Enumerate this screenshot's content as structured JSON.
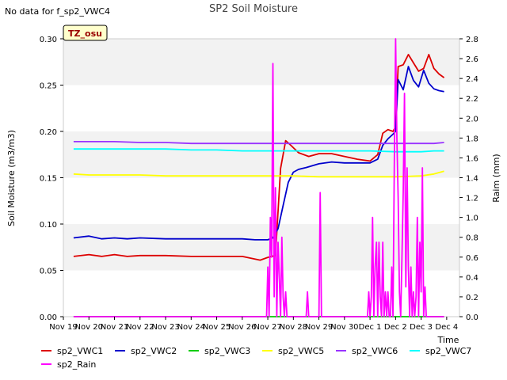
{
  "chart_data": {
    "type": "line",
    "title": "SP2 Soil Moisture",
    "corner_note": "No data for f_sp2_VWC4",
    "badge": "TZ_osu",
    "xlabel": "Time",
    "ylabel": "Soil Moisture (m3/m3)",
    "y2label": "Raim (mm)",
    "xlim": [
      0,
      15.5
    ],
    "ylim": [
      0,
      0.3
    ],
    "y2lim": [
      0,
      2.8
    ],
    "x_ticks": [
      {
        "x": 0,
        "label": "Nov 19"
      },
      {
        "x": 1,
        "label": "Nov 20"
      },
      {
        "x": 2,
        "label": "Nov 21"
      },
      {
        "x": 3,
        "label": "Nov 22"
      },
      {
        "x": 4,
        "label": "Nov 23"
      },
      {
        "x": 5,
        "label": "Nov 24"
      },
      {
        "x": 6,
        "label": "Nov 25"
      },
      {
        "x": 7,
        "label": "Nov 26"
      },
      {
        "x": 8,
        "label": "Nov 27"
      },
      {
        "x": 9,
        "label": "Nov 28"
      },
      {
        "x": 10,
        "label": "Nov 29"
      },
      {
        "x": 11,
        "label": "Nov 30"
      },
      {
        "x": 12,
        "label": "Dec 1"
      },
      {
        "x": 13,
        "label": "Dec 2"
      },
      {
        "x": 14,
        "label": "Dec 3"
      },
      {
        "x": 15,
        "label": "Dec 4"
      }
    ],
    "y_ticks": [
      "0.00",
      "0.05",
      "0.10",
      "0.15",
      "0.20",
      "0.25",
      "0.30"
    ],
    "y2_ticks": [
      "0.0",
      "0.2",
      "0.4",
      "0.6",
      "0.8",
      "1.0",
      "1.2",
      "1.4",
      "1.6",
      "1.8",
      "2.0",
      "2.2",
      "2.4",
      "2.6",
      "2.8"
    ],
    "series": [
      {
        "name": "sp2_VWC1",
        "axis": "left",
        "color": "#dd0000",
        "x": [
          0.4,
          1.0,
          1.5,
          2.0,
          2.5,
          3.0,
          4.0,
          5.0,
          6.0,
          7.0,
          7.7,
          8.0,
          8.3,
          8.5,
          8.7,
          8.9,
          9.2,
          9.6,
          10.0,
          10.5,
          11.0,
          11.5,
          12.0,
          12.3,
          12.5,
          12.7,
          12.9,
          13.0,
          13.1,
          13.3,
          13.5,
          13.7,
          13.9,
          14.1,
          14.3,
          14.5,
          14.7,
          14.9
        ],
        "y": [
          0.065,
          0.067,
          0.065,
          0.067,
          0.065,
          0.066,
          0.066,
          0.065,
          0.065,
          0.065,
          0.061,
          0.064,
          0.066,
          0.16,
          0.19,
          0.185,
          0.177,
          0.173,
          0.176,
          0.176,
          0.173,
          0.17,
          0.168,
          0.175,
          0.198,
          0.202,
          0.2,
          0.205,
          0.27,
          0.272,
          0.283,
          0.274,
          0.265,
          0.268,
          0.283,
          0.268,
          0.262,
          0.258
        ]
      },
      {
        "name": "sp2_VWC2",
        "axis": "left",
        "color": "#0000cc",
        "x": [
          0.4,
          1.0,
          1.5,
          2.0,
          2.5,
          3.0,
          4.0,
          5.0,
          6.0,
          7.0,
          7.5,
          8.0,
          8.2,
          8.4,
          8.6,
          8.8,
          9.0,
          9.2,
          9.5,
          10.0,
          10.5,
          11.0,
          11.5,
          12.0,
          12.3,
          12.5,
          12.7,
          12.9,
          13.0,
          13.1,
          13.3,
          13.5,
          13.7,
          13.9,
          14.1,
          14.3,
          14.5,
          14.7,
          14.9
        ],
        "y": [
          0.085,
          0.087,
          0.084,
          0.085,
          0.084,
          0.085,
          0.084,
          0.084,
          0.084,
          0.084,
          0.083,
          0.083,
          0.085,
          0.095,
          0.12,
          0.145,
          0.156,
          0.159,
          0.161,
          0.165,
          0.167,
          0.166,
          0.166,
          0.166,
          0.17,
          0.185,
          0.192,
          0.197,
          0.2,
          0.256,
          0.245,
          0.27,
          0.255,
          0.248,
          0.266,
          0.252,
          0.246,
          0.244,
          0.243
        ]
      },
      {
        "name": "sp2_VWC3",
        "axis": "left",
        "color": "#00cc00",
        "x": [
          0.4,
          14.9
        ],
        "y": [
          0.0,
          0.0
        ]
      },
      {
        "name": "sp2_VWC5",
        "axis": "left",
        "color": "#ffff00",
        "x": [
          0.4,
          1.0,
          2.0,
          3.0,
          4.0,
          5.0,
          6.0,
          7.0,
          8.0,
          9.0,
          10.0,
          11.0,
          12.0,
          13.0,
          14.0,
          14.5,
          14.9
        ],
        "y": [
          0.154,
          0.153,
          0.153,
          0.153,
          0.152,
          0.152,
          0.152,
          0.152,
          0.152,
          0.152,
          0.151,
          0.151,
          0.151,
          0.151,
          0.152,
          0.154,
          0.157
        ]
      },
      {
        "name": "sp2_VWC6",
        "axis": "left",
        "color": "#9933ff",
        "x": [
          0.4,
          1.0,
          2.0,
          3.0,
          4.0,
          5.0,
          6.0,
          7.0,
          8.0,
          9.0,
          10.0,
          11.0,
          12.0,
          13.0,
          14.0,
          14.5,
          14.9
        ],
        "y": [
          0.189,
          0.189,
          0.189,
          0.188,
          0.188,
          0.187,
          0.187,
          0.187,
          0.187,
          0.187,
          0.187,
          0.187,
          0.187,
          0.187,
          0.187,
          0.187,
          0.188
        ]
      },
      {
        "name": "sp2_VWC7",
        "axis": "left",
        "color": "#00ffff",
        "x": [
          0.4,
          1.0,
          2.0,
          3.0,
          4.0,
          5.0,
          6.0,
          7.0,
          8.0,
          9.0,
          10.0,
          11.0,
          12.0,
          13.0,
          14.0,
          14.5,
          14.9
        ],
        "y": [
          0.181,
          0.181,
          0.181,
          0.181,
          0.181,
          0.18,
          0.18,
          0.179,
          0.179,
          0.179,
          0.179,
          0.179,
          0.179,
          0.178,
          0.178,
          0.179,
          0.179
        ]
      },
      {
        "name": "sp2_Rain",
        "axis": "right",
        "color": "#ff00ff",
        "x": [
          0.4,
          7.95,
          8.0,
          8.05,
          8.1,
          8.15,
          8.2,
          8.25,
          8.3,
          8.35,
          8.4,
          8.45,
          8.5,
          8.55,
          8.6,
          8.65,
          8.7,
          8.75,
          8.8,
          9.5,
          9.55,
          9.6,
          10.0,
          10.05,
          10.1,
          10.15,
          10.2,
          11.9,
          11.95,
          12.0,
          12.05,
          12.1,
          12.15,
          12.2,
          12.25,
          12.3,
          12.35,
          12.4,
          12.45,
          12.5,
          12.55,
          12.6,
          12.65,
          12.7,
          12.75,
          12.8,
          12.85,
          12.9,
          12.95,
          13.0,
          13.05,
          13.1,
          13.15,
          13.2,
          13.25,
          13.3,
          13.35,
          13.4,
          13.45,
          13.5,
          13.55,
          13.6,
          13.65,
          13.7,
          13.75,
          13.8,
          13.85,
          13.9,
          13.95,
          14.0,
          14.05,
          14.1,
          14.15,
          14.2,
          14.25,
          14.3,
          14.35,
          14.9
        ],
        "y": [
          0.0,
          0.0,
          0.5,
          0.0,
          1.0,
          0.6,
          2.55,
          0.2,
          1.3,
          0.0,
          0.75,
          0.4,
          0.0,
          0.8,
          0.2,
          0.0,
          0.25,
          0.0,
          0.0,
          0.0,
          0.25,
          0.0,
          0.0,
          1.25,
          0.0,
          0.0,
          0.0,
          0.0,
          0.25,
          0.0,
          0.2,
          1.0,
          0.0,
          0.5,
          0.75,
          0.0,
          0.75,
          0.2,
          0.0,
          0.75,
          0.0,
          0.25,
          0.0,
          0.25,
          0.0,
          0.0,
          0.5,
          0.0,
          1.5,
          2.8,
          1.8,
          1.2,
          0.25,
          0.0,
          0.6,
          1.25,
          2.25,
          0.3,
          1.5,
          0.5,
          0.0,
          0.5,
          0.0,
          0.25,
          0.0,
          0.2,
          1.0,
          0.0,
          0.75,
          0.25,
          1.5,
          0.0,
          0.3,
          0.0,
          0.0,
          0.0,
          0.0,
          0.0
        ]
      }
    ],
    "legend_placement": "bottom",
    "grid": false,
    "background_bands": true
  }
}
